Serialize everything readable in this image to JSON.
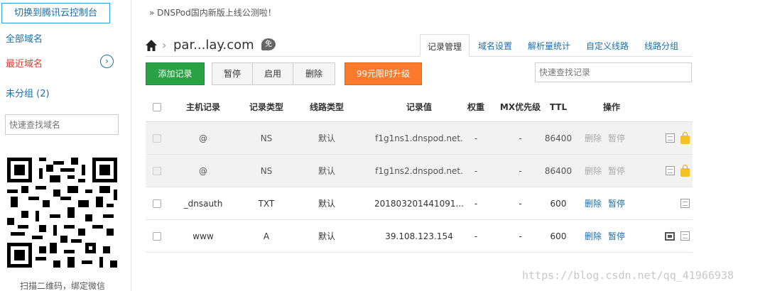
{
  "sidebar": {
    "switch_button": "切换到腾讯云控制台",
    "all_domains": "全部域名",
    "recent_domains": "最近域名",
    "ungrouped": "未分组 (2)",
    "search_placeholder": "快速查找域名",
    "qr_caption": "扫描二维码，绑定微信"
  },
  "notice": "» DNSPod国内新版上线公测啦！",
  "breadcrumb": {
    "domain": "par...lay.com",
    "badge": "免"
  },
  "tabs": [
    "记录管理",
    "域名设置",
    "解析量统计",
    "自定义线路",
    "线路分组"
  ],
  "toolbar": {
    "add": "添加记录",
    "pause": "暂停",
    "enable": "启用",
    "delete": "删除",
    "upgrade": "99元限时升级",
    "search_placeholder": "快速查找记录"
  },
  "table": {
    "headers": [
      "主机记录",
      "记录类型",
      "线路类型",
      "记录值",
      "权重",
      "MX优先级",
      "TTL",
      "操作"
    ],
    "rows": [
      {
        "host": "@",
        "type": "NS",
        "line": "默认",
        "value": "f1g1ns1.dnspod.net.",
        "weight": "-",
        "mx": "-",
        "ttl": "86400",
        "del": "删除",
        "pause": "暂停"
      },
      {
        "host": "@",
        "type": "NS",
        "line": "默认",
        "value": "f1g1ns2.dnspod.net.",
        "weight": "-",
        "mx": "-",
        "ttl": "86400",
        "del": "删除",
        "pause": "暂停"
      },
      {
        "host": "_dnsauth",
        "type": "TXT",
        "line": "默认",
        "value": "201803201441091...",
        "weight": "-",
        "mx": "-",
        "ttl": "600",
        "del": "删除",
        "pause": "暂停"
      },
      {
        "host": "www",
        "type": "A",
        "line": "默认",
        "value": "39.108.123.154",
        "weight": "-",
        "mx": "-",
        "ttl": "600",
        "del": "删除",
        "pause": "暂停"
      }
    ]
  },
  "watermark": "https://blog.csdn.net/qq_41966938",
  "colors": {
    "accent": "#1a6fa8",
    "add_green": "#2aa145",
    "upgrade_orange": "#fb7a2c",
    "active_red": "#e03a2f"
  }
}
